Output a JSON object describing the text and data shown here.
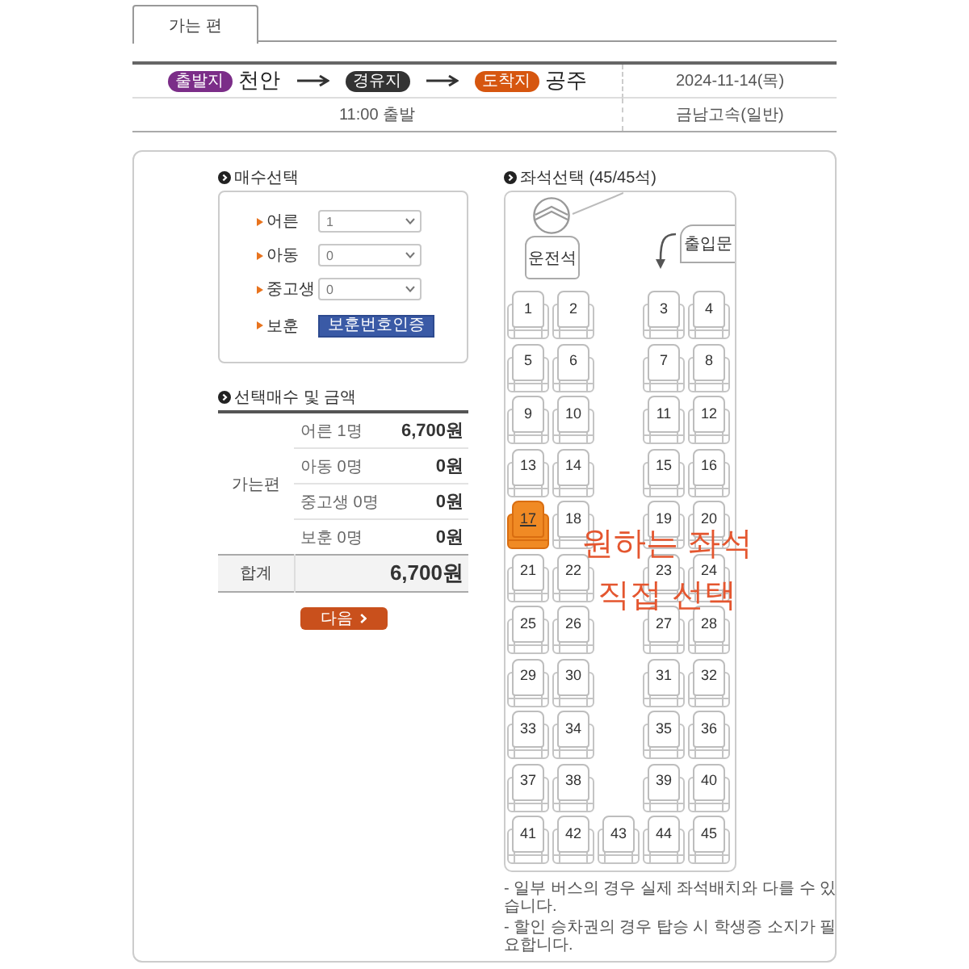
{
  "tabs": [
    {
      "label": "가는 편",
      "selected": true
    }
  ],
  "route": {
    "stops": [
      {
        "badge": "출발지",
        "place": "천안",
        "color": "#7b2d88"
      },
      {
        "badge": "경유지",
        "color": "#333333"
      },
      {
        "badge": "도착지",
        "place": "공주",
        "color": "#d6560f"
      }
    ],
    "date": "2024-11-14(목)",
    "departure_time": "11:00 출발",
    "company": "금남고속(일반)"
  },
  "ticket_count": {
    "title": "매수선택",
    "rows": [
      {
        "kind": "select",
        "label": "어른",
        "value": "1"
      },
      {
        "kind": "select",
        "label": "아동",
        "value": "0"
      },
      {
        "kind": "select",
        "label": "중고생",
        "value": "0"
      },
      {
        "kind": "button",
        "label": "보훈",
        "button": "보훈번호인증"
      }
    ]
  },
  "summary": {
    "title": "선택매수 및 금액",
    "direction": "가는편",
    "items": [
      {
        "label": "어른 1명",
        "amount": "6,700원"
      },
      {
        "label": "아동 0명",
        "amount": "0원"
      },
      {
        "label": "중고생 0명",
        "amount": "0원"
      },
      {
        "label": "보훈 0명",
        "amount": "0원"
      }
    ],
    "total_label": "합계",
    "total": "6,700원"
  },
  "next_button": "다음",
  "seat_selection": {
    "title": "좌석선택 (45/45석)",
    "driver_seat": "운전석",
    "door": "출입문",
    "seat_rows": [
      {
        "seats": [
          {
            "number": "1",
            "selected": false
          },
          {
            "number": "2",
            "selected": false
          },
          {
            "number": "3",
            "selected": false
          },
          {
            "number": "4",
            "selected": false
          }
        ]
      },
      {
        "seats": [
          {
            "number": "5",
            "selected": false
          },
          {
            "number": "6",
            "selected": false
          },
          {
            "number": "7",
            "selected": false
          },
          {
            "number": "8",
            "selected": false
          }
        ]
      },
      {
        "seats": [
          {
            "number": "9",
            "selected": false
          },
          {
            "number": "10",
            "selected": false
          },
          {
            "number": "11",
            "selected": false
          },
          {
            "number": "12",
            "selected": false
          }
        ]
      },
      {
        "seats": [
          {
            "number": "13",
            "selected": false
          },
          {
            "number": "14",
            "selected": false
          },
          {
            "number": "15",
            "selected": false
          },
          {
            "number": "16",
            "selected": false
          }
        ]
      },
      {
        "seats": [
          {
            "number": "17",
            "selected": true
          },
          {
            "number": "18",
            "selected": false
          },
          {
            "number": "19",
            "selected": false
          },
          {
            "number": "20",
            "selected": false
          }
        ]
      },
      {
        "seats": [
          {
            "number": "21",
            "selected": false
          },
          {
            "number": "22",
            "selected": false
          },
          {
            "number": "23",
            "selected": false
          },
          {
            "number": "24",
            "selected": false
          }
        ]
      },
      {
        "seats": [
          {
            "number": "25",
            "selected": false
          },
          {
            "number": "26",
            "selected": false
          },
          {
            "number": "27",
            "selected": false
          },
          {
            "number": "28",
            "selected": false
          }
        ]
      },
      {
        "seats": [
          {
            "number": "29",
            "selected": false
          },
          {
            "number": "30",
            "selected": false
          },
          {
            "number": "31",
            "selected": false
          },
          {
            "number": "32",
            "selected": false
          }
        ]
      },
      {
        "seats": [
          {
            "number": "33",
            "selected": false
          },
          {
            "number": "34",
            "selected": false
          },
          {
            "number": "35",
            "selected": false
          },
          {
            "number": "36",
            "selected": false
          }
        ]
      },
      {
        "seats": [
          {
            "number": "37",
            "selected": false
          },
          {
            "number": "38",
            "selected": false
          },
          {
            "number": "39",
            "selected": false
          },
          {
            "number": "40",
            "selected": false
          }
        ]
      },
      {
        "seats": [
          {
            "number": "41",
            "selected": false
          },
          {
            "number": "42",
            "selected": false
          },
          {
            "number": "43",
            "selected": false
          },
          {
            "number": "44",
            "selected": false
          },
          {
            "number": "45",
            "selected": false
          }
        ]
      }
    ],
    "annotation_lines": [
      "원하는 좌석",
      "직접 선택"
    ]
  },
  "notes": [
    "- 일부 버스의 경우 실제 좌석배치와 다를 수 있습니다.",
    "- 할인 승차권의 경우 탑승 시 학생증 소지가 필요합니다."
  ]
}
